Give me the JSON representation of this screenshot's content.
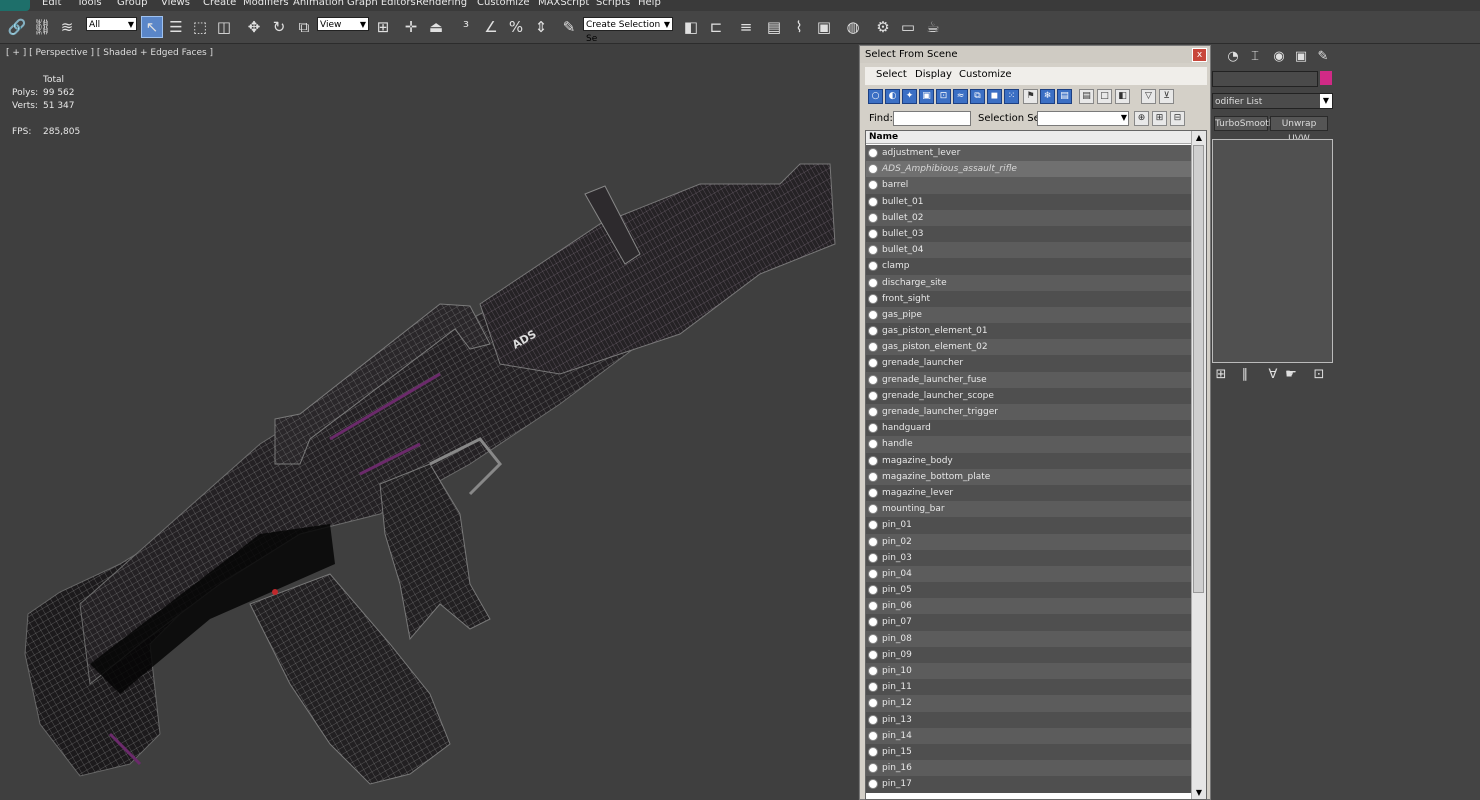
{
  "menubar": {
    "items": [
      "Edit",
      "Tools",
      "Group",
      "Views",
      "Create",
      "Modifiers",
      "Animation",
      "Graph Editors",
      "Rendering",
      "Customize",
      "MAXScript",
      "Scripts",
      "Help"
    ]
  },
  "toolbar": {
    "selection_filter": "All",
    "reference_coord": "View",
    "named_selection": "Create Selection Se"
  },
  "viewport": {
    "label": "[ + ] [ Perspective ] [ Shaded + Edged Faces ]",
    "stats_header": "Total",
    "polys_label": "Polys:",
    "polys_value": "99 562",
    "verts_label": "Verts:",
    "verts_value": "51 347",
    "fps_label": "FPS:",
    "fps_value": "285,805",
    "model_text": "ADS"
  },
  "right_panel": {
    "modifier_list": "odifier List",
    "buttons": [
      "TurboSmooth",
      "Unwrap UVW"
    ],
    "swatch_color": "#d02a86"
  },
  "dialog": {
    "title": "Select From Scene",
    "close": "x",
    "menu": [
      "Select",
      "Display",
      "Customize"
    ],
    "find_label": "Find:",
    "selection_set_label": "Selection Set:",
    "column_name": "Name",
    "objects": [
      "adjustment_lever",
      "ADS_Amphibious_assault_rifle",
      "barrel",
      "bullet_01",
      "bullet_02",
      "bullet_03",
      "bullet_04",
      "clamp",
      "discharge_site",
      "front_sight",
      "gas_pipe",
      "gas_piston_element_01",
      "gas_piston_element_02",
      "grenade_launcher",
      "grenade_launcher_fuse",
      "grenade_launcher_scope",
      "grenade_launcher_trigger",
      "handguard",
      "handle",
      "magazine_body",
      "magazine_bottom_plate",
      "magazine_lever",
      "mounting_bar",
      "pin_01",
      "pin_02",
      "pin_03",
      "pin_04",
      "pin_05",
      "pin_06",
      "pin_07",
      "pin_08",
      "pin_09",
      "pin_10",
      "pin_11",
      "pin_12",
      "pin_13",
      "pin_14",
      "pin_15",
      "pin_16",
      "pin_17"
    ],
    "selected_index": 1
  }
}
